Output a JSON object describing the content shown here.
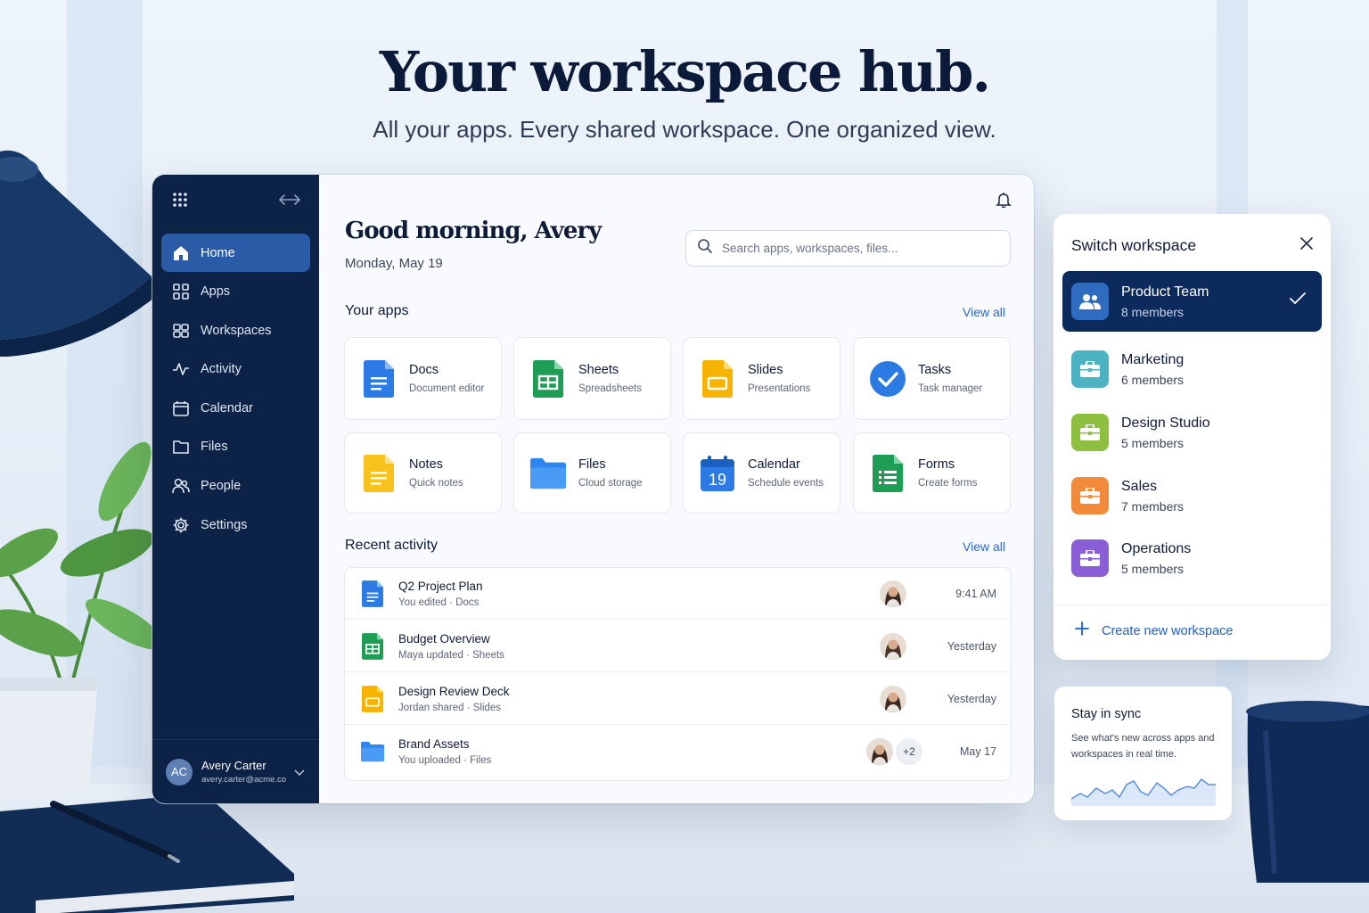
{
  "hero": {
    "title": "Your workspace hub.",
    "subtitle": "All your apps. Every shared workspace. One organized view."
  },
  "sidebar": {
    "items": [
      {
        "label": "Home",
        "icon": "home-icon",
        "active": true
      },
      {
        "label": "Apps",
        "icon": "grid-icon"
      },
      {
        "label": "Workspaces",
        "icon": "workspaces-icon"
      },
      {
        "label": "Activity",
        "icon": "activity-icon"
      },
      {
        "label": "Calendar",
        "icon": "calendar-icon"
      },
      {
        "label": "Files",
        "icon": "folder-icon"
      },
      {
        "label": "People",
        "icon": "people-icon"
      },
      {
        "label": "Settings",
        "icon": "gear-icon"
      }
    ],
    "user": {
      "initials": "AC",
      "name": "Avery Carter",
      "email": "avery.carter@acme.co"
    }
  },
  "main": {
    "greeting": "Good morning, Avery",
    "date": "Monday, May 19",
    "search_placeholder": "Search apps, workspaces, files...",
    "apps_title": "Your apps",
    "apps_view_all": "View all",
    "apps": [
      {
        "name": "Docs",
        "desc": "Document editor",
        "icon": "docs-icon"
      },
      {
        "name": "Sheets",
        "desc": "Spreadsheets",
        "icon": "sheets-icon"
      },
      {
        "name": "Slides",
        "desc": "Presentations",
        "icon": "slides-icon"
      },
      {
        "name": "Tasks",
        "desc": "Task manager",
        "icon": "tasks-icon"
      },
      {
        "name": "Notes",
        "desc": "Quick notes",
        "icon": "notes-icon"
      },
      {
        "name": "Files",
        "desc": "Cloud storage",
        "icon": "files-icon"
      },
      {
        "name": "Calendar",
        "desc": "Schedule events",
        "icon": "calendar-app-icon",
        "day": "19"
      },
      {
        "name": "Forms",
        "desc": "Create forms",
        "icon": "forms-icon"
      }
    ],
    "recent_title": "Recent activity",
    "recent_view_all": "View all",
    "recent": [
      {
        "title": "Q2 Project Plan",
        "meta": "You edited · Docs",
        "time": "9:41 AM",
        "icon": "docs-icon"
      },
      {
        "title": "Budget Overview",
        "meta": "Maya updated · Sheets",
        "time": "Yesterday",
        "icon": "sheets-icon"
      },
      {
        "title": "Design Review Deck",
        "meta": "Jordan shared · Slides",
        "time": "Yesterday",
        "icon": "slides-icon"
      },
      {
        "title": "Brand Assets",
        "meta": "You uploaded · Files",
        "time": "May 17",
        "icon": "files-icon",
        "extra": "+2"
      }
    ]
  },
  "workspace_panel": {
    "title": "Switch workspace",
    "workspaces": [
      {
        "name": "Product Team",
        "count": "8 members",
        "color": "#2f6cc0",
        "active": true
      },
      {
        "name": "Marketing",
        "count": "6 members",
        "color": "#4db3c2"
      },
      {
        "name": "Design Studio",
        "count": "5 members",
        "color": "#8fbf3f"
      },
      {
        "name": "Sales",
        "count": "7 members",
        "color": "#f28a3c"
      },
      {
        "name": "Operations",
        "count": "5 members",
        "color": "#8a5fd6"
      }
    ],
    "create_label": "Create new workspace"
  },
  "sync_card": {
    "title": "Stay in sync",
    "desc": "See what's new across apps and workspaces in real time."
  },
  "colors": {
    "sidebar_bg": "#0d2247",
    "active_nav": "#2a5ba6",
    "link": "#2a67d2"
  }
}
